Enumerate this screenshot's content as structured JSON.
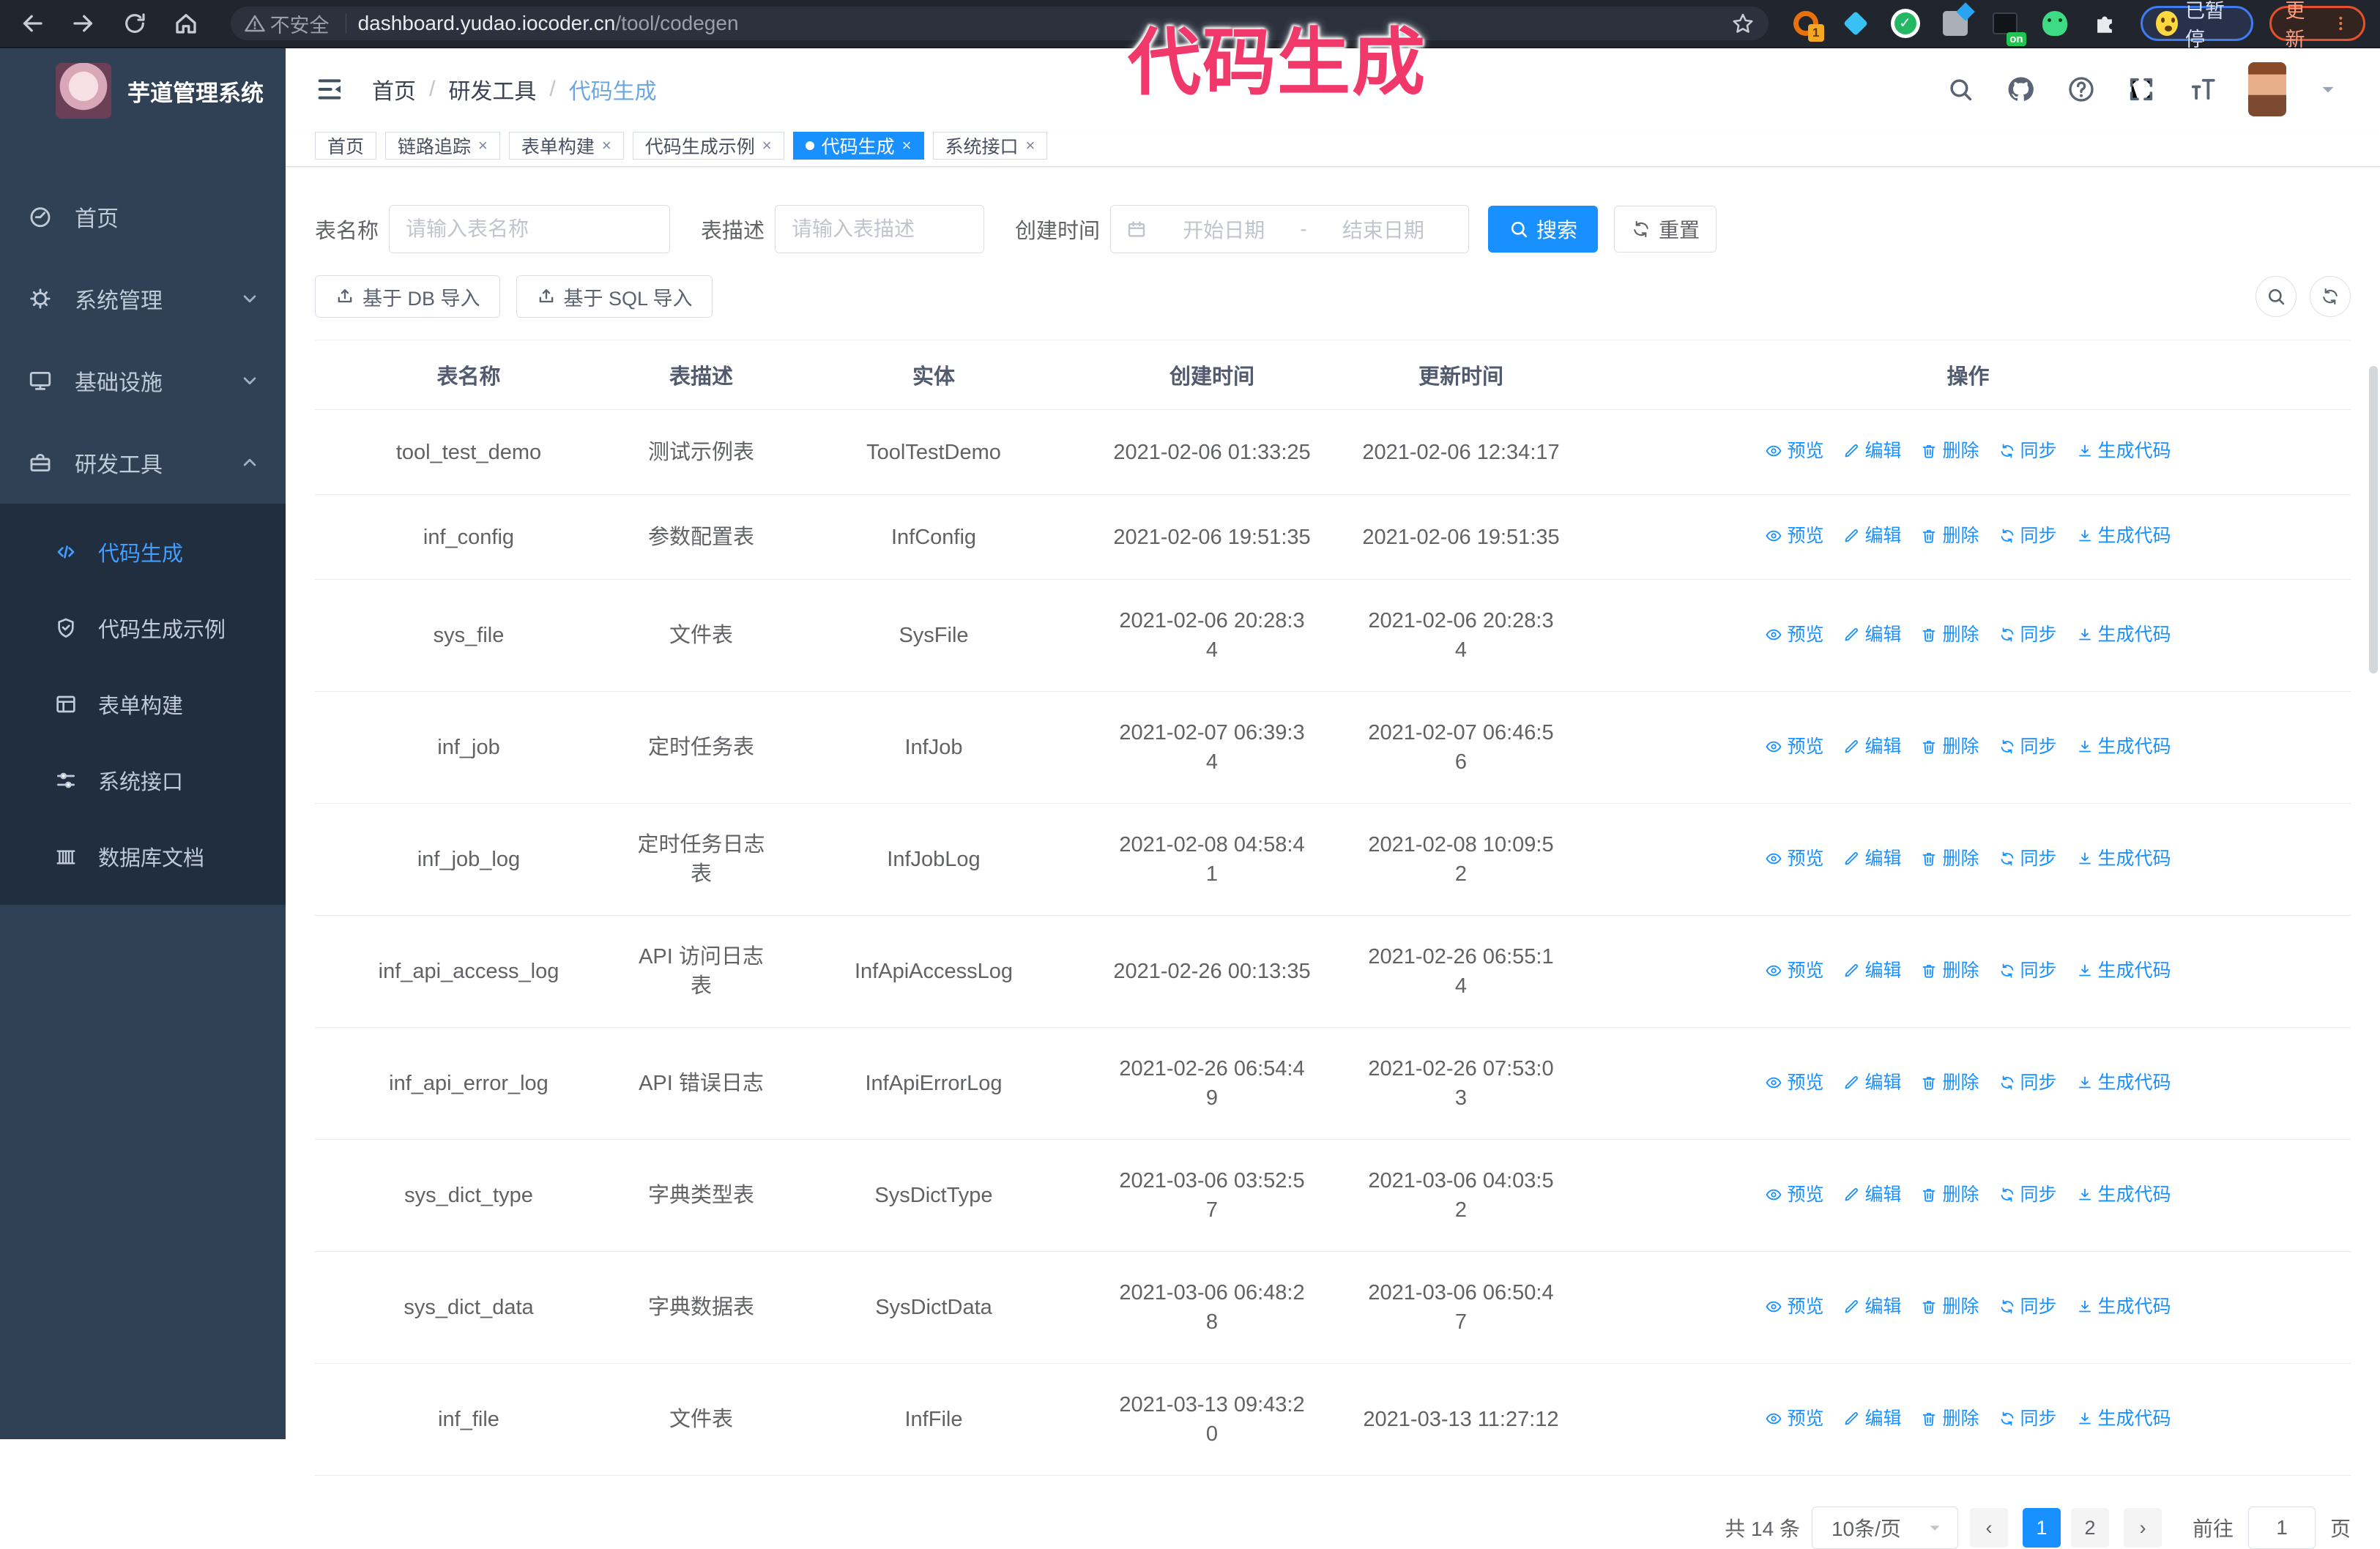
{
  "browser": {
    "security_label": "不安全",
    "url_host": "dashboard.yudao.iocoder.cn",
    "url_path": "/tool/codegen",
    "extension_count_badge": "1",
    "extension_on_badge": "on",
    "paused_badge": "已暂停",
    "update_button": "更新"
  },
  "annotation": {
    "text": "代码生成",
    "color": "#f1386b"
  },
  "sidebar": {
    "app_title": "芋道管理系统",
    "menu": [
      {
        "label": "首页",
        "icon": "dashboard-icon",
        "chevron": ""
      },
      {
        "label": "系统管理",
        "icon": "gear-icon",
        "chevron": "down"
      },
      {
        "label": "基础设施",
        "icon": "monitor-icon",
        "chevron": "down"
      },
      {
        "label": "研发工具",
        "icon": "toolbox-icon",
        "chevron": "up"
      }
    ],
    "submenu": [
      {
        "label": "代码生成",
        "icon": "code-icon",
        "active": true
      },
      {
        "label": "代码生成示例",
        "icon": "shield-check-icon",
        "active": false
      },
      {
        "label": "表单构建",
        "icon": "form-icon",
        "active": false
      },
      {
        "label": "系统接口",
        "icon": "sliders-icon",
        "active": false
      },
      {
        "label": "数据库文档",
        "icon": "database-doc-icon",
        "active": false
      }
    ]
  },
  "header": {
    "breadcrumb": [
      "首页",
      "研发工具",
      "代码生成"
    ]
  },
  "tags": [
    {
      "label": "首页",
      "closable": false,
      "active": false
    },
    {
      "label": "链路追踪",
      "closable": true,
      "active": false
    },
    {
      "label": "表单构建",
      "closable": true,
      "active": false
    },
    {
      "label": "代码生成示例",
      "closable": true,
      "active": false
    },
    {
      "label": "代码生成",
      "closable": true,
      "active": true
    },
    {
      "label": "系统接口",
      "closable": true,
      "active": false
    }
  ],
  "filters": {
    "table_name_label": "表名称",
    "table_name_placeholder": "请输入表名称",
    "table_desc_label": "表描述",
    "table_desc_placeholder": "请输入表描述",
    "create_time_label": "创建时间",
    "date_start_placeholder": "开始日期",
    "date_separator": "-",
    "date_end_placeholder": "结束日期",
    "search_button": "搜索",
    "reset_button": "重置"
  },
  "toolbar": {
    "import_db_button": "基于 DB 导入",
    "import_sql_button": "基于 SQL 导入"
  },
  "table": {
    "columns": [
      "表名称",
      "表描述",
      "实体",
      "创建时间",
      "更新时间",
      "操作"
    ],
    "action_labels": [
      "预览",
      "编辑",
      "删除",
      "同步",
      "生成代码"
    ],
    "action_icons": [
      "eye-icon",
      "edit-icon",
      "delete-icon",
      "sync-icon",
      "download-icon"
    ],
    "rows": [
      {
        "name": "tool_test_demo",
        "desc": "测试示例表",
        "entity": "ToolTestDemo",
        "created": "2021-02-06 01:33:25",
        "updated": "2021-02-06 12:34:17"
      },
      {
        "name": "inf_config",
        "desc": "参数配置表",
        "entity": "InfConfig",
        "created": "2021-02-06 19:51:35",
        "updated": "2021-02-06 19:51:35"
      },
      {
        "name": "sys_file",
        "desc": "文件表",
        "entity": "SysFile",
        "created": "2021-02-06 20:28:3\n4",
        "updated": "2021-02-06 20:28:3\n4"
      },
      {
        "name": "inf_job",
        "desc": "定时任务表",
        "entity": "InfJob",
        "created": "2021-02-07 06:39:3\n4",
        "updated": "2021-02-07 06:46:5\n6"
      },
      {
        "name": "inf_job_log",
        "desc": "定时任务日志表",
        "entity": "InfJobLog",
        "created": "2021-02-08 04:58:4\n1",
        "updated": "2021-02-08 10:09:5\n2"
      },
      {
        "name": "inf_api_access_log",
        "desc": "API 访问日志表",
        "entity": "InfApiAccessLog",
        "created": "2021-02-26 00:13:35",
        "updated": "2021-02-26 06:55:1\n4"
      },
      {
        "name": "inf_api_error_log",
        "desc": "API 错误日志",
        "entity": "InfApiErrorLog",
        "created": "2021-02-26 06:54:4\n9",
        "updated": "2021-02-26 07:53:0\n3"
      },
      {
        "name": "sys_dict_type",
        "desc": "字典类型表",
        "entity": "SysDictType",
        "created": "2021-03-06 03:52:5\n7",
        "updated": "2021-03-06 04:03:5\n2"
      },
      {
        "name": "sys_dict_data",
        "desc": "字典数据表",
        "entity": "SysDictData",
        "created": "2021-03-06 06:48:2\n8",
        "updated": "2021-03-06 06:50:4\n7"
      },
      {
        "name": "inf_file",
        "desc": "文件表",
        "entity": "InfFile",
        "created": "2021-03-13 09:43:2\n0",
        "updated": "2021-03-13 11:27:12"
      }
    ]
  },
  "pagination": {
    "total_text": "共 14 条",
    "page_size_value": "10条/页",
    "pages": [
      {
        "label": "1",
        "active": true
      },
      {
        "label": "2",
        "active": false
      }
    ],
    "goto_label": "前往",
    "goto_value": "1",
    "goto_unit": "页"
  },
  "colors": {
    "primary": "#1890ff",
    "sidebar_bg": "#304156",
    "submenu_bg": "#212e3f",
    "active_link": "#409eff",
    "annotation": "#f1386b"
  }
}
